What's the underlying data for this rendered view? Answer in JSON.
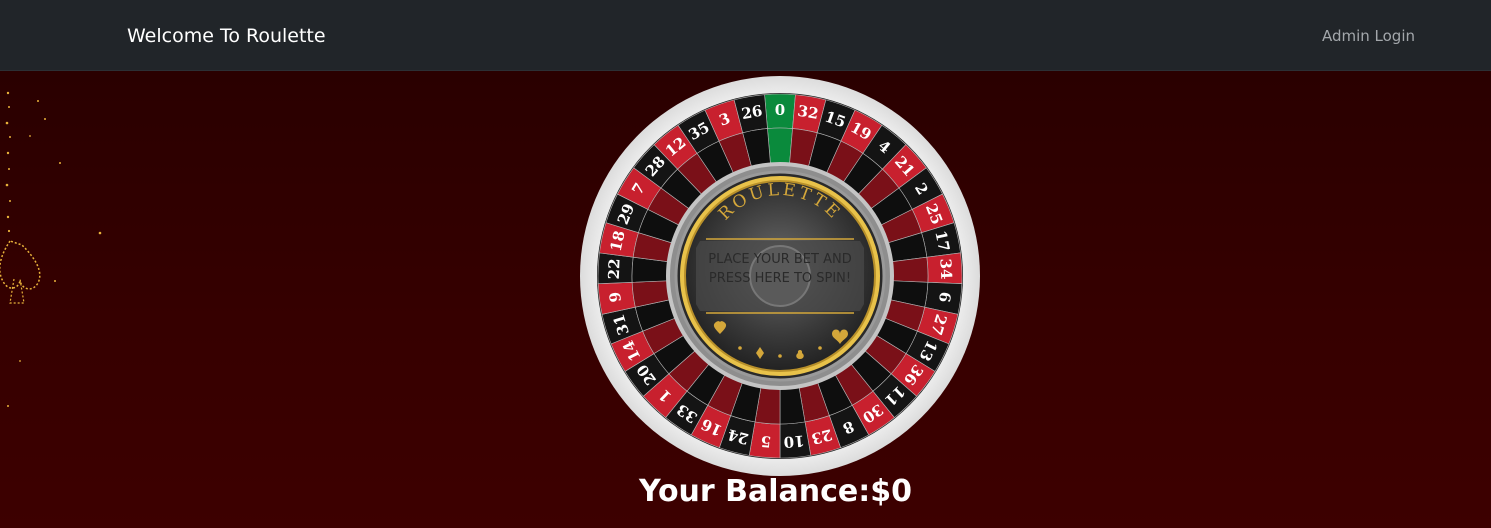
{
  "navbar": {
    "brand": "Welcome To Roulette",
    "admin_link": "Admin Login"
  },
  "wheel": {
    "logo_text": "ROULETTE",
    "spin_prompt": "PLACE YOUR BET AND PRESS HERE TO SPIN!",
    "numbers": [
      0,
      32,
      15,
      19,
      4,
      21,
      2,
      25,
      17,
      34,
      6,
      27,
      13,
      36,
      11,
      30,
      8,
      23,
      10,
      5,
      24,
      16,
      33,
      1,
      20,
      14,
      31,
      9,
      22,
      18,
      29,
      7,
      28,
      12,
      35,
      3,
      26
    ],
    "colors": {
      "green": "#0a8a3c",
      "red": "#c8202e",
      "black": "#141414",
      "gold": "#d4a73a"
    }
  },
  "balance": {
    "label": "Your Balance:",
    "value": "$0"
  }
}
